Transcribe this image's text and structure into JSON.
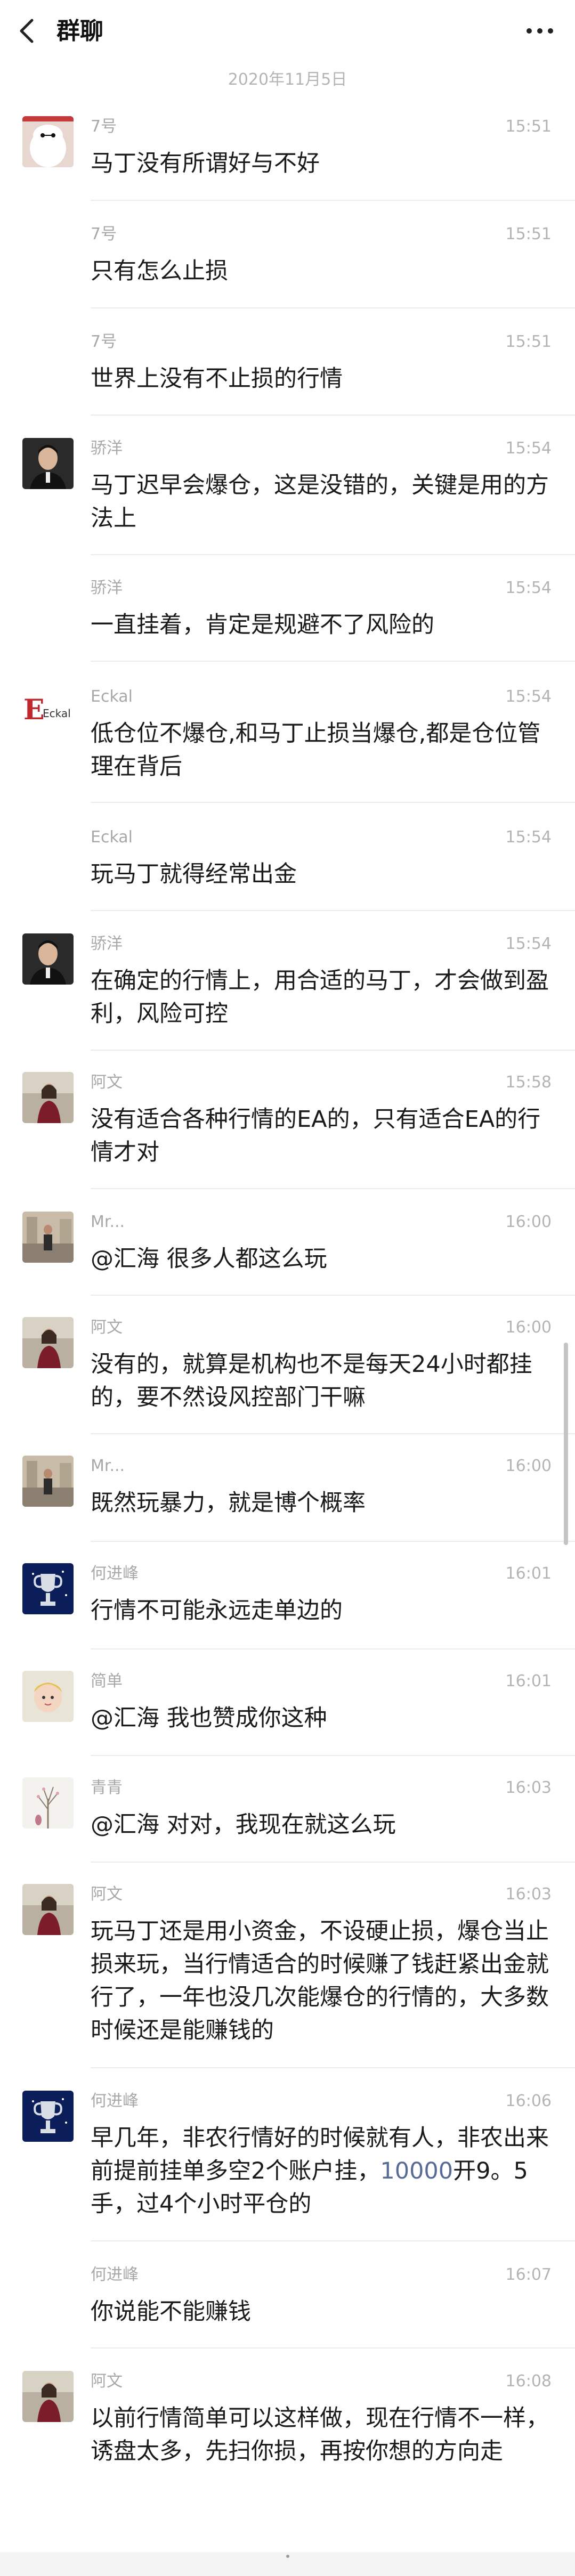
{
  "header": {
    "title": "群聊"
  },
  "date_separator": "2020年11月5日",
  "messages": [
    {
      "sender": "7号",
      "time": "15:51",
      "text": "马丁没有所谓好与不好"
    },
    {
      "sender": "7号",
      "time": "15:51",
      "text": "只有怎么止损"
    },
    {
      "sender": "7号",
      "time": "15:51",
      "text": "世界上没有不止损的行情"
    },
    {
      "sender": "骄洋",
      "time": "15:54",
      "text": "马丁迟早会爆仓，这是没错的，关键是用的方法上"
    },
    {
      "sender": "骄洋",
      "time": "15:54",
      "text": "一直挂着，肯定是规避不了风险的"
    },
    {
      "sender": "Eckal",
      "time": "15:54",
      "text": "低仓位不爆仓,和马丁止损当爆仓,都是仓位管理在背后"
    },
    {
      "sender": "Eckal",
      "time": "15:54",
      "text": "玩马丁就得经常出金"
    },
    {
      "sender": "骄洋",
      "time": "15:54",
      "text": "在确定的行情上，用合适的马丁，才会做到盈利，风险可控"
    },
    {
      "sender": "阿文",
      "time": "15:58",
      "text": "没有适合各种行情的EA的，只有适合EA的行情才对"
    },
    {
      "sender": "Mr...",
      "time": "16:00",
      "text": "@汇海 很多人都这么玩"
    },
    {
      "sender": "阿文",
      "time": "16:00",
      "text": "没有的，就算是机构也不是每天24小时都挂的，要不然设风控部门干嘛"
    },
    {
      "sender": "Mr...",
      "time": "16:00",
      "text": "既然玩暴力，就是博个概率"
    },
    {
      "sender": "何进峰",
      "time": "16:01",
      "text": "行情不可能永远走单边的"
    },
    {
      "sender": "简单",
      "time": "16:01",
      "text": "@汇海 我也赞成你这种"
    },
    {
      "sender": "青青",
      "time": "16:03",
      "text": "@汇海 对对，我现在就这么玩"
    },
    {
      "sender": "阿文",
      "time": "16:03",
      "text": "玩马丁还是用小资金，不设硬止损，爆仓当止损来玩，当行情适合的时候赚了钱赶紧出金就行了，一年也没几次能爆仓的行情的，大多数时候还是能赚钱的"
    },
    {
      "sender": "何进峰",
      "time": "16:06",
      "text_before": "早几年，非农行情好的时候就有人，非农出来前提前挂单多空2个账户挂，",
      "text_link": "10000",
      "text_after": "开9。5手，过4个小时平仓的"
    },
    {
      "sender": "何进峰",
      "time": "16:07",
      "text": "你说能不能赚钱"
    },
    {
      "sender": "阿文",
      "time": "16:08",
      "text": "以前行情简单可以这样做，现在行情不一样，诱盘太多，先扫你损，再按你想的方向走"
    }
  ],
  "avatars": {
    "7号": "baymax-avatar",
    "骄洋": "man-portrait-avatar",
    "Eckal": "eckal-logo-avatar",
    "阿文": "woman-photo-avatar",
    "Mr...": "street-photo-avatar",
    "何进峰": "trophy-avatar",
    "简单": "baby-photo-avatar",
    "青青": "tree-photo-avatar"
  },
  "avatar_logo_text": "Eckal",
  "colors": {
    "link": "#576b95",
    "timestamp": "#b4b4b4",
    "sender": "#a8a8a8"
  }
}
